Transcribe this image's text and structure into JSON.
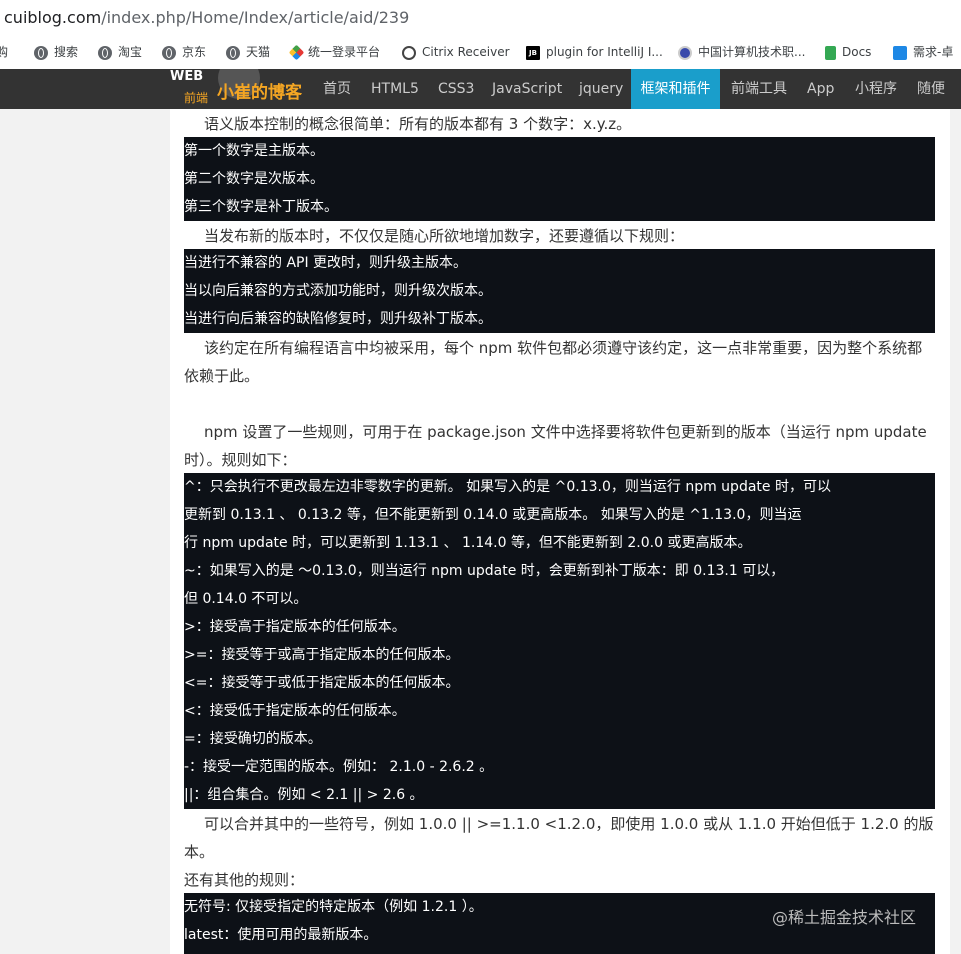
{
  "browser": {
    "url_host": "cuiblog.com",
    "url_path": "/index.php/Home/Index/article/aid/239",
    "bookmarks": [
      {
        "label": "购",
        "icon": "none"
      },
      {
        "label": "搜索",
        "icon": "globe-icon"
      },
      {
        "label": "淘宝",
        "icon": "globe-icon"
      },
      {
        "label": "京东",
        "icon": "globe-icon"
      },
      {
        "label": "天猫",
        "icon": "globe-icon"
      },
      {
        "label": "统一登录平台",
        "icon": "diamond-icon"
      },
      {
        "label": "Citrix Receiver",
        "icon": "citrix-icon"
      },
      {
        "label": "plugin for IntelliJ I...",
        "icon": "jetbrains-icon"
      },
      {
        "label": "中国计算机技术职...",
        "icon": "csai-icon"
      },
      {
        "label": "Docs",
        "icon": "docs-icon"
      },
      {
        "label": "需求-卓",
        "icon": "tracker-icon"
      }
    ]
  },
  "site": {
    "logo_web": "WEB",
    "logo_fe": "前端",
    "title": "小崔的博客",
    "nav": [
      "首页",
      "HTML5",
      "CSS3",
      "JavaScript",
      "jquery",
      "框架和插件",
      "前端工具",
      "App",
      "小程序",
      "随便"
    ],
    "active_nav": "框架和插件"
  },
  "article": {
    "p1": "语义版本控制的概念很简单：所有的版本都有 3 个数字：x.y.z。",
    "code1": [
      "第一个数字是主版本。",
      "第二个数字是次版本。",
      "第三个数字是补丁版本。"
    ],
    "p2": "当发布新的版本时，不仅仅是随心所欲地增加数字，还要遵循以下规则：",
    "code2": [
      "当进行不兼容的 API 更改时，则升级主版本。",
      "当以向后兼容的方式添加功能时，则升级次版本。",
      "当进行向后兼容的缺陷修复时，则升级补丁版本。"
    ],
    "p3": "该约定在所有编程语言中均被采用，每个 npm 软件包都必须遵守该约定，这一点非常重要，因为整个系统都依赖于此。",
    "p4": "npm 设置了一些规则，可用于在 package.json 文件中选择要将软件包更新到的版本（当运行 npm update 时）。规则如下：",
    "rules": [
      " ^：只会执行不更改最左边非零数字的更新。 如果写入的是 ^0.13.0，则当运行 npm update 时，可以",
      "更新到 0.13.1 、 0.13.2 等，但不能更新到 0.14.0 或更高版本。 如果写入的是 ^1.13.0，则当运",
      "行 npm update 时，可以更新到 1.13.1 、 1.14.0 等，但不能更新到 2.0.0 或更高版本。",
      " ~：如果写入的是 〜0.13.0，则当运行 npm update 时，会更新到补丁版本：即 0.13.1 可以，",
      "但 0.14.0 不可以。",
      " >：接受高于指定版本的任何版本。",
      " >=：接受等于或高于指定版本的任何版本。",
      " <=：接受等于或低于指定版本的任何版本。",
      " <：接受低于指定版本的任何版本。",
      " =：接受确切的版本。",
      " -：接受一定范围的版本。例如： 2.1.0 - 2.6.2 。",
      " ||：组合集合。例如 < 2.1 || > 2.6 。"
    ],
    "p5": "可以合并其中的一些符号，例如 1.0.0 || >=1.1.0 <1.2.0，即使用 1.0.0 或从 1.1.0 开始但低于 1.2.0 的版本。",
    "p6": "还有其他的规则：",
    "code4": [
      "无符号: 仅接受指定的特定版本（例如 1.2.1 ）。",
      " latest：使用可用的最新版本。"
    ]
  },
  "watermark": "@稀土掘金技术社区"
}
